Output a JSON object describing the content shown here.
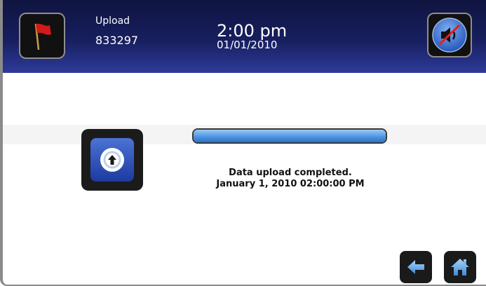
{
  "header": {
    "mode_label": "Upload",
    "device_id": "833297",
    "time": "2:00 pm",
    "date": "01/01/2010"
  },
  "icons": {
    "flag": "flag-icon",
    "mute": "speaker-muted-icon",
    "upload": "upload-arrow-icon",
    "back": "back-arrow-icon",
    "home": "home-icon"
  },
  "progress": {
    "percent": 100
  },
  "status": {
    "message": "Data upload completed.",
    "timestamp": "January 1, 2010  02:00:00 PM"
  },
  "colors": {
    "header_dark": "#0f1440",
    "header_light": "#2e3a9a",
    "progress_fill": "#4f97e2",
    "flag_red": "#d11a1a",
    "mute_slash": "#e02020"
  }
}
